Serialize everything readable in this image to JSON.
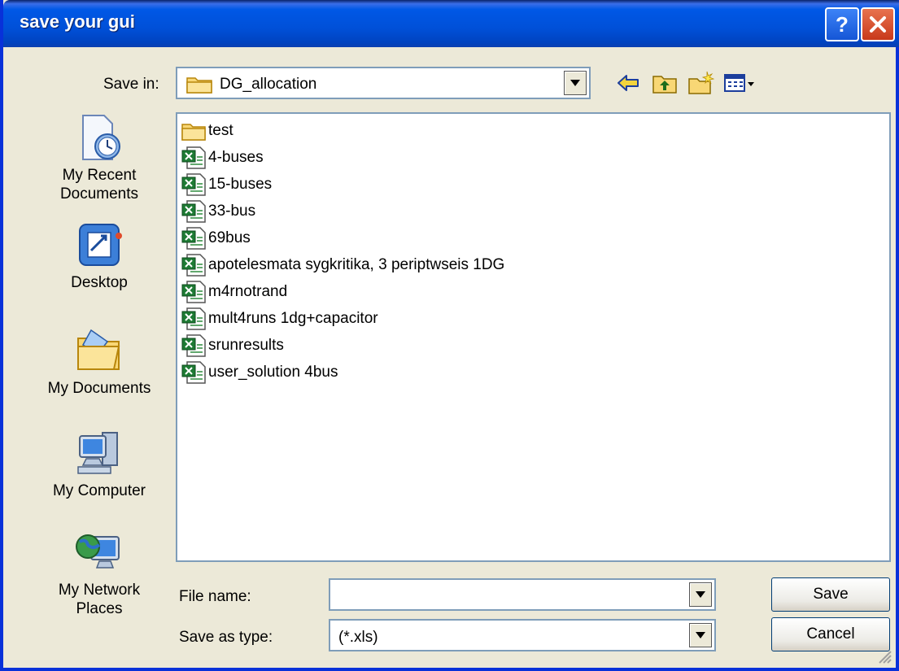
{
  "window": {
    "title": "save your gui"
  },
  "save_in": {
    "label": "Save in:",
    "value": "DG_allocation"
  },
  "toolbar": {
    "icons": [
      "back-icon",
      "up-folder-icon",
      "new-folder-icon",
      "view-menu-icon"
    ]
  },
  "places": [
    {
      "label": "My Recent Documents",
      "icon": "recent-documents-icon"
    },
    {
      "label": "Desktop",
      "icon": "desktop-icon"
    },
    {
      "label": "My Documents",
      "icon": "my-documents-icon"
    },
    {
      "label": "My Computer",
      "icon": "my-computer-icon"
    },
    {
      "label": "My Network Places",
      "icon": "network-places-icon"
    }
  ],
  "files": [
    {
      "name": "test",
      "type": "folder"
    },
    {
      "name": "4-buses",
      "type": "excel"
    },
    {
      "name": "15-buses",
      "type": "excel"
    },
    {
      "name": "33-bus",
      "type": "excel"
    },
    {
      "name": "69bus",
      "type": "excel"
    },
    {
      "name": "apotelesmata sygkritika, 3 periptwseis 1DG",
      "type": "excel"
    },
    {
      "name": "m4rnotrand",
      "type": "excel"
    },
    {
      "name": "mult4runs 1dg+capacitor",
      "type": "excel"
    },
    {
      "name": "srunresults",
      "type": "excel"
    },
    {
      "name": "user_solution 4bus",
      "type": "excel"
    }
  ],
  "file_name": {
    "label": "File name:",
    "value": ""
  },
  "save_as_type": {
    "label": "Save as type:",
    "value": "(*.xls)"
  },
  "buttons": {
    "save": "Save",
    "cancel": "Cancel"
  },
  "colors": {
    "titlebar": "#0054E3",
    "frame": "#0831D9",
    "dialog_bg": "#ECE9D8",
    "field_border": "#7F9DB9"
  }
}
